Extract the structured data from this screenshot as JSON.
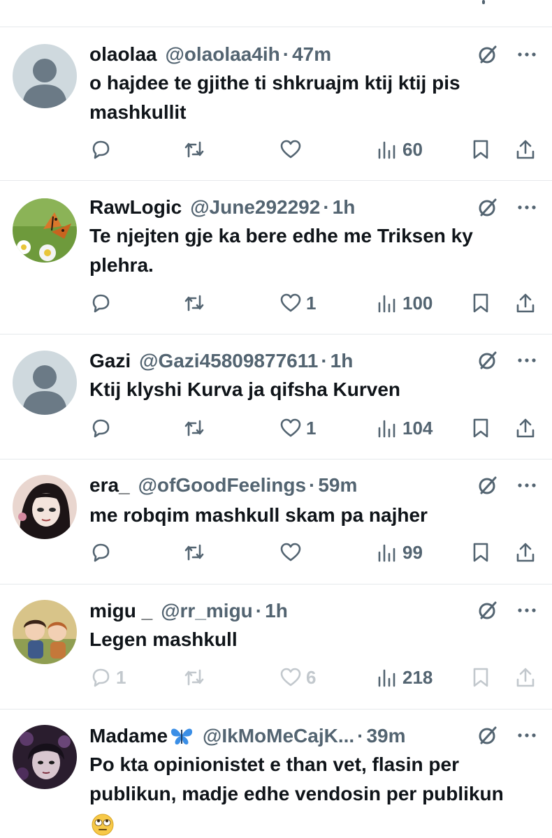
{
  "tweets": [
    {
      "name": "olaolaa",
      "handle": "@olaolaa4ih",
      "time": "47m",
      "text": "o hajdee te gjithe ti shkruajm ktij ktij pis mashkullit",
      "replies": "",
      "retweets": "",
      "likes": "",
      "views": "60",
      "avatar": "default-avatar",
      "dim_actions": false
    },
    {
      "name": "RawLogic",
      "handle": "@June292292",
      "time": "1h",
      "text": "Te njejten gje ka bere edhe me Triksen ky plehra.",
      "replies": "",
      "retweets": "",
      "likes": "1",
      "views": "100",
      "avatar": "butterfly-photo-avatar",
      "dim_actions": false
    },
    {
      "name": "Gazi",
      "handle": "@Gazi45809877611",
      "time": "1h",
      "text": "Ktij klyshi Kurva ja qifsha Kurven",
      "replies": "",
      "retweets": "",
      "likes": "1",
      "views": "104",
      "avatar": "default-avatar",
      "dim_actions": false
    },
    {
      "name": "era_",
      "handle": "@ofGoodFeelings",
      "time": "59m",
      "text": "me robqim mashkull skam pa najher",
      "replies": "",
      "retweets": "",
      "likes": "",
      "views": "99",
      "avatar": "cartoon-girl-avatar",
      "dim_actions": false
    },
    {
      "name": "migu _",
      "handle": "@rr_migu",
      "time": "1h",
      "text": "Legen mashkull",
      "replies": "1",
      "retweets": "",
      "likes": "6",
      "views": "218",
      "avatar": "illustrated-children-avatar",
      "dim_actions": true
    },
    {
      "name": "Madame",
      "handle": "@IkMoMeCajK...",
      "time": "39m",
      "text": "Po kta opinionistet e than vet, flasin per publikun, madje edhe vendosin per publikun",
      "replies": "",
      "retweets": "",
      "likes": "",
      "views": "",
      "avatar": "dark-portrait-avatar",
      "dim_actions": false,
      "name_emoji": "blue-butterfly-emoji",
      "text_emoji": "eye-roll-emoji"
    }
  ],
  "colors": {
    "text": "#0f1419",
    "muted": "#536471",
    "divider": "#e6e9ec",
    "default_avatar_bg": "#cfd9de",
    "default_avatar_fg": "#6b7a86",
    "butterfly_blue": "#3a8ee6"
  }
}
